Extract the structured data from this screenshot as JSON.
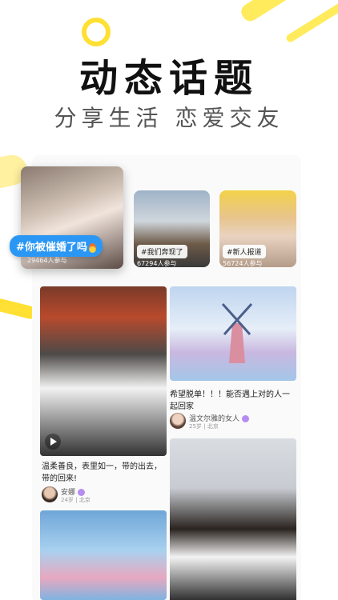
{
  "header": {
    "title": "动态话题",
    "subtitle": "分享生活  恋爱交友"
  },
  "topics": [
    {
      "tag": "#你被催婚了吗",
      "count": "29464人参与",
      "icon": "fire-icon"
    },
    {
      "tag": "#我们奔现了",
      "count": "67294人参与"
    },
    {
      "tag": "#新人报道",
      "count": "56724人参与"
    }
  ],
  "feed": [
    {
      "text": "温柔善良，表里如一，带的出去，带的回来!",
      "author": "安娜",
      "meta": "24岁 | 北京",
      "has_video": true
    },
    {
      "text": "希望脱单！！！能否遇上对的人一起回家",
      "author": "温文尔雅的女人",
      "meta": "25岁 | 北京"
    }
  ],
  "colors": {
    "accent_yellow": "#ffe033",
    "tag_blue": "#2b97f5",
    "verify_purple": "#b68cf2"
  }
}
